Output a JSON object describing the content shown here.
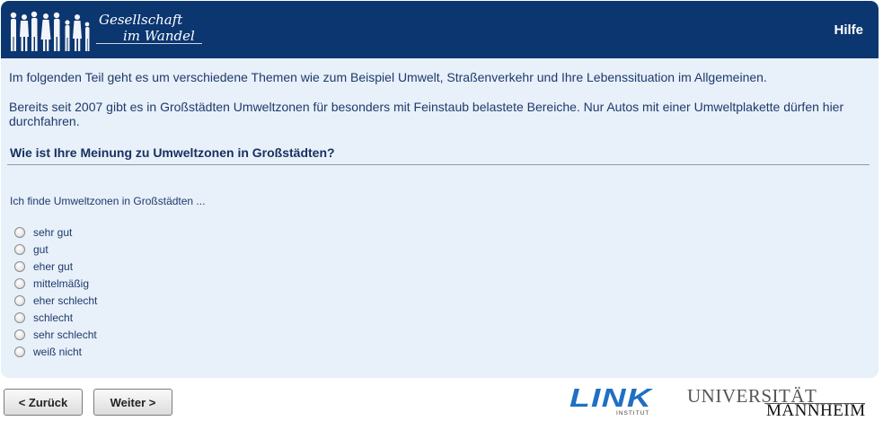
{
  "header": {
    "logo_line1": "Gesellschaft",
    "logo_line2": "im Wandel",
    "help_label": "Hilfe",
    "colors": {
      "header_bg": "#0b3670",
      "panel_bg": "#e8f0fa"
    }
  },
  "intro_text": "Im folgenden Teil geht es um verschiedene Themen wie zum Beispiel Umwelt, Straßenverkehr und Ihre Lebenssituation im Allgemeinen.",
  "context_text": "Bereits seit 2007 gibt es in Großstädten Umweltzonen für besonders mit Feinstaub belastete Bereiche. Nur Autos mit einer Umweltplakette dürfen hier durchfahren.",
  "question": "Wie ist Ihre Meinung zu Umweltzonen in Großstädten?",
  "stem": "Ich finde Umweltzonen in Großstädten ...",
  "options": [
    "sehr gut",
    "gut",
    "eher gut",
    "mittelmäßig",
    "eher schlecht",
    "schlecht",
    "sehr schlecht",
    "weiß nicht"
  ],
  "nav": {
    "back_label": "< Zurück",
    "next_label": "Weiter >"
  },
  "footer": {
    "link_logo_text": "LINK",
    "link_logo_sub": "INSTITUT",
    "uni_line1": "UNIVERSITÄT",
    "uni_line2": "MANNHEIM"
  }
}
